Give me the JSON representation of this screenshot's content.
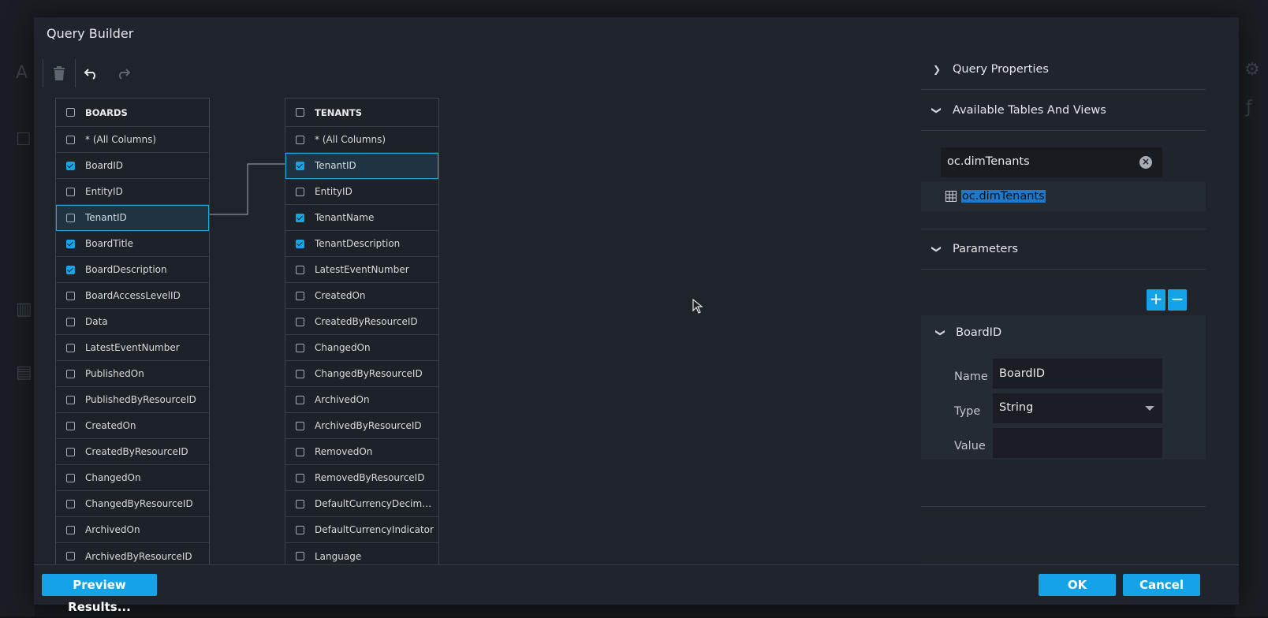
{
  "dialog": {
    "title": "Query Builder"
  },
  "toolbar": {
    "delete_icon": "trash-icon",
    "undo_icon": "undo-icon",
    "redo_icon": "redo-icon"
  },
  "tables": {
    "boards": {
      "name": "BOARDS",
      "columns": [
        {
          "label": "* (All Columns)",
          "checked": false
        },
        {
          "label": "BoardID",
          "checked": true
        },
        {
          "label": "EntityID",
          "checked": false
        },
        {
          "label": "TenantID",
          "checked": false,
          "selected": true
        },
        {
          "label": "BoardTitle",
          "checked": true
        },
        {
          "label": "BoardDescription",
          "checked": true
        },
        {
          "label": "BoardAccessLevelID",
          "checked": false
        },
        {
          "label": "Data",
          "checked": false
        },
        {
          "label": "LatestEventNumber",
          "checked": false
        },
        {
          "label": "PublishedOn",
          "checked": false
        },
        {
          "label": "PublishedByResourceID",
          "checked": false
        },
        {
          "label": "CreatedOn",
          "checked": false
        },
        {
          "label": "CreatedByResourceID",
          "checked": false
        },
        {
          "label": "ChangedOn",
          "checked": false
        },
        {
          "label": "ChangedByResourceID",
          "checked": false
        },
        {
          "label": "ArchivedOn",
          "checked": false
        },
        {
          "label": "ArchivedByResourceID",
          "checked": false
        }
      ]
    },
    "tenants": {
      "name": "TENANTS",
      "columns": [
        {
          "label": "* (All Columns)",
          "checked": false
        },
        {
          "label": "TenantID",
          "checked": true,
          "selected": true
        },
        {
          "label": "EntityID",
          "checked": false
        },
        {
          "label": "TenantName",
          "checked": true
        },
        {
          "label": "TenantDescription",
          "checked": true
        },
        {
          "label": "LatestEventNumber",
          "checked": false
        },
        {
          "label": "CreatedOn",
          "checked": false
        },
        {
          "label": "CreatedByResourceID",
          "checked": false
        },
        {
          "label": "ChangedOn",
          "checked": false
        },
        {
          "label": "ChangedByResourceID",
          "checked": false
        },
        {
          "label": "ArchivedOn",
          "checked": false
        },
        {
          "label": "ArchivedByResourceID",
          "checked": false
        },
        {
          "label": "RemovedOn",
          "checked": false
        },
        {
          "label": "RemovedByResourceID",
          "checked": false
        },
        {
          "label": "DefaultCurrencyDecimalDi...",
          "checked": false
        },
        {
          "label": "DefaultCurrencyIndicator",
          "checked": false
        },
        {
          "label": "Language",
          "checked": false
        }
      ]
    }
  },
  "panel": {
    "query_properties": "Query Properties",
    "available_tables": "Available Tables And Views",
    "search_value": "oc.dimTenants",
    "result_item": "oc.dimTenants",
    "parameters": "Parameters",
    "param": {
      "title": "BoardID",
      "name_label": "Name",
      "name_value": "BoardID",
      "type_label": "Type",
      "type_value": "String",
      "value_label": "Value",
      "value_value": ""
    }
  },
  "footer": {
    "preview_label": "Preview Results...",
    "ok_label": "OK",
    "cancel_label": "Cancel"
  },
  "colors": {
    "accent": "#14a3e6",
    "dialog_bg": "#20252d",
    "selection": "#1f78c8"
  }
}
